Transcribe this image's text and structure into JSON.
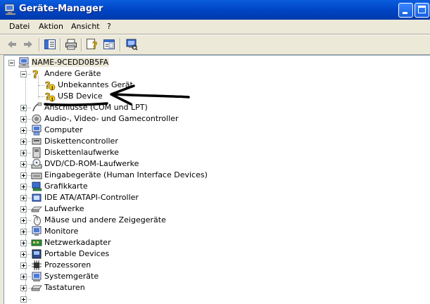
{
  "window": {
    "title": "Geräte-Manager",
    "icons": {
      "app": "device-manager-icon",
      "minimize": "minimize-icon",
      "maximize": "maximize-icon"
    }
  },
  "menu": [
    "Datei",
    "Aktion",
    "Ansicht",
    "?"
  ],
  "toolbar": [
    "back-arrow-icon",
    "forward-arrow-icon",
    "show-hide-console-tree-icon",
    "print-icon",
    "help-icon",
    "properties-icon",
    "scan-hardware-icon"
  ],
  "tree": {
    "root": {
      "label": "NAME-9CEDD0B5FA",
      "icon": "computer-icon"
    },
    "categories": [
      {
        "label": "Andere Geräte",
        "icon": "unknown-device-question-icon",
        "expanded": true,
        "children": [
          {
            "label": "Unbekanntes Gerät",
            "icon": "unknown-device-warning-icon"
          },
          {
            "label": "USB Device",
            "icon": "unknown-device-warning-icon"
          }
        ]
      },
      {
        "label": "Anschlüsse (COM und LPT)",
        "icon": "port-icon"
      },
      {
        "label": "Audio-, Video- und Gamecontroller",
        "icon": "speaker-icon"
      },
      {
        "label": "Computer",
        "icon": "computer-icon"
      },
      {
        "label": "Diskettencontroller",
        "icon": "floppy-controller-icon"
      },
      {
        "label": "Diskettenlaufwerke",
        "icon": "floppy-drive-icon"
      },
      {
        "label": "DVD/CD-ROM-Laufwerke",
        "icon": "cd-drive-icon"
      },
      {
        "label": "Eingabegeräte (Human Interface Devices)",
        "icon": "keyboard-icon"
      },
      {
        "label": "Grafikkarte",
        "icon": "display-adapter-icon"
      },
      {
        "label": "IDE ATA/ATAPI-Controller",
        "icon": "ide-controller-icon"
      },
      {
        "label": "Laufwerke",
        "icon": "disk-drive-icon"
      },
      {
        "label": "Mäuse und andere Zeigegeräte",
        "icon": "mouse-icon"
      },
      {
        "label": "Monitore",
        "icon": "monitor-icon"
      },
      {
        "label": "Netzwerkadapter",
        "icon": "network-adapter-icon"
      },
      {
        "label": "Portable Devices",
        "icon": "portable-device-icon"
      },
      {
        "label": "Prozessoren",
        "icon": "processor-icon"
      },
      {
        "label": "Systemgeräte",
        "icon": "system-device-icon"
      },
      {
        "label": "Tastaturen",
        "icon": "keyboard-icon"
      }
    ]
  },
  "annotation": {
    "icon": "hand-drawn-arrow-icon"
  },
  "colors": {
    "titlebar": "#0054e3",
    "face": "#ece9d8",
    "tree_bg": "#ffffff",
    "arrow": "#000000"
  }
}
